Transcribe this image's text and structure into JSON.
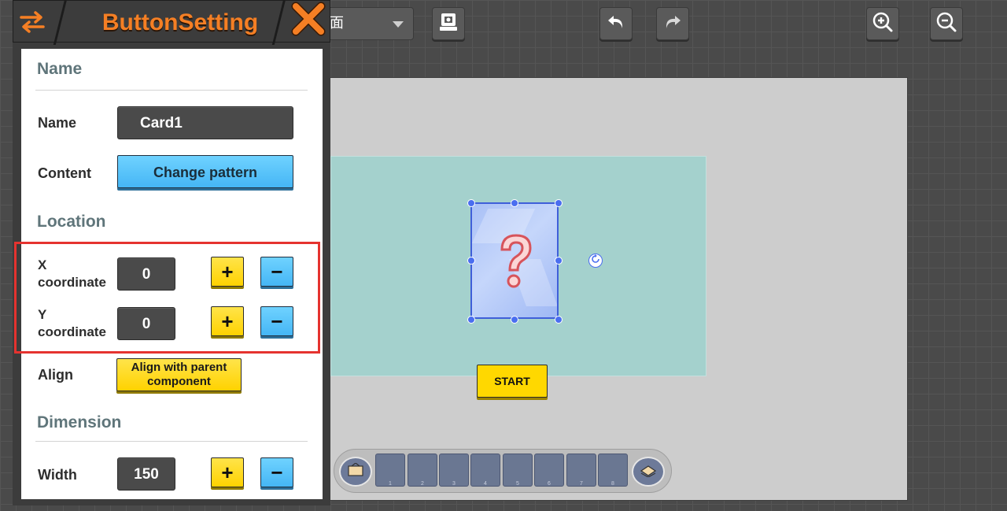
{
  "toolbar": {
    "scene_value": "面",
    "buttons": [
      {
        "id": "export",
        "icon": "export-icon"
      },
      {
        "id": "undo",
        "icon": "undo-icon"
      },
      {
        "id": "redo",
        "icon": "redo-icon"
      },
      {
        "id": "zoom_in",
        "icon": "zoom-in-icon"
      },
      {
        "id": "zoom_out",
        "icon": "zoom-out-icon"
      }
    ]
  },
  "panel": {
    "title": "ButtonSetting",
    "swap_icon": "swap-arrows-icon",
    "close_icon": "close-x-icon",
    "sections": {
      "name": {
        "title": "Name",
        "name_label": "Name",
        "name_value": "Card1",
        "content_label": "Content",
        "content_button": "Change pattern"
      },
      "location": {
        "title": "Location",
        "x_label": "X coordinate",
        "x_value": "0",
        "y_label": "Y coordinate",
        "y_value": "0",
        "plus": "+",
        "minus": "−",
        "align_label": "Align",
        "align_button": "Align with parent component"
      },
      "dimension": {
        "title": "Dimension",
        "width_label": "Width",
        "width_value": "150"
      }
    }
  },
  "canvas": {
    "card_symbol": "?",
    "start_label": "START",
    "layer_slots": [
      "1",
      "2",
      "3",
      "4",
      "5",
      "6",
      "7",
      "8"
    ]
  },
  "colors": {
    "accent_orange": "#f57f24",
    "highlight_red": "#e5332f",
    "button_blue": "#45b6f5",
    "button_yellow": "#ffd200",
    "card_border": "#3f5fd9"
  }
}
